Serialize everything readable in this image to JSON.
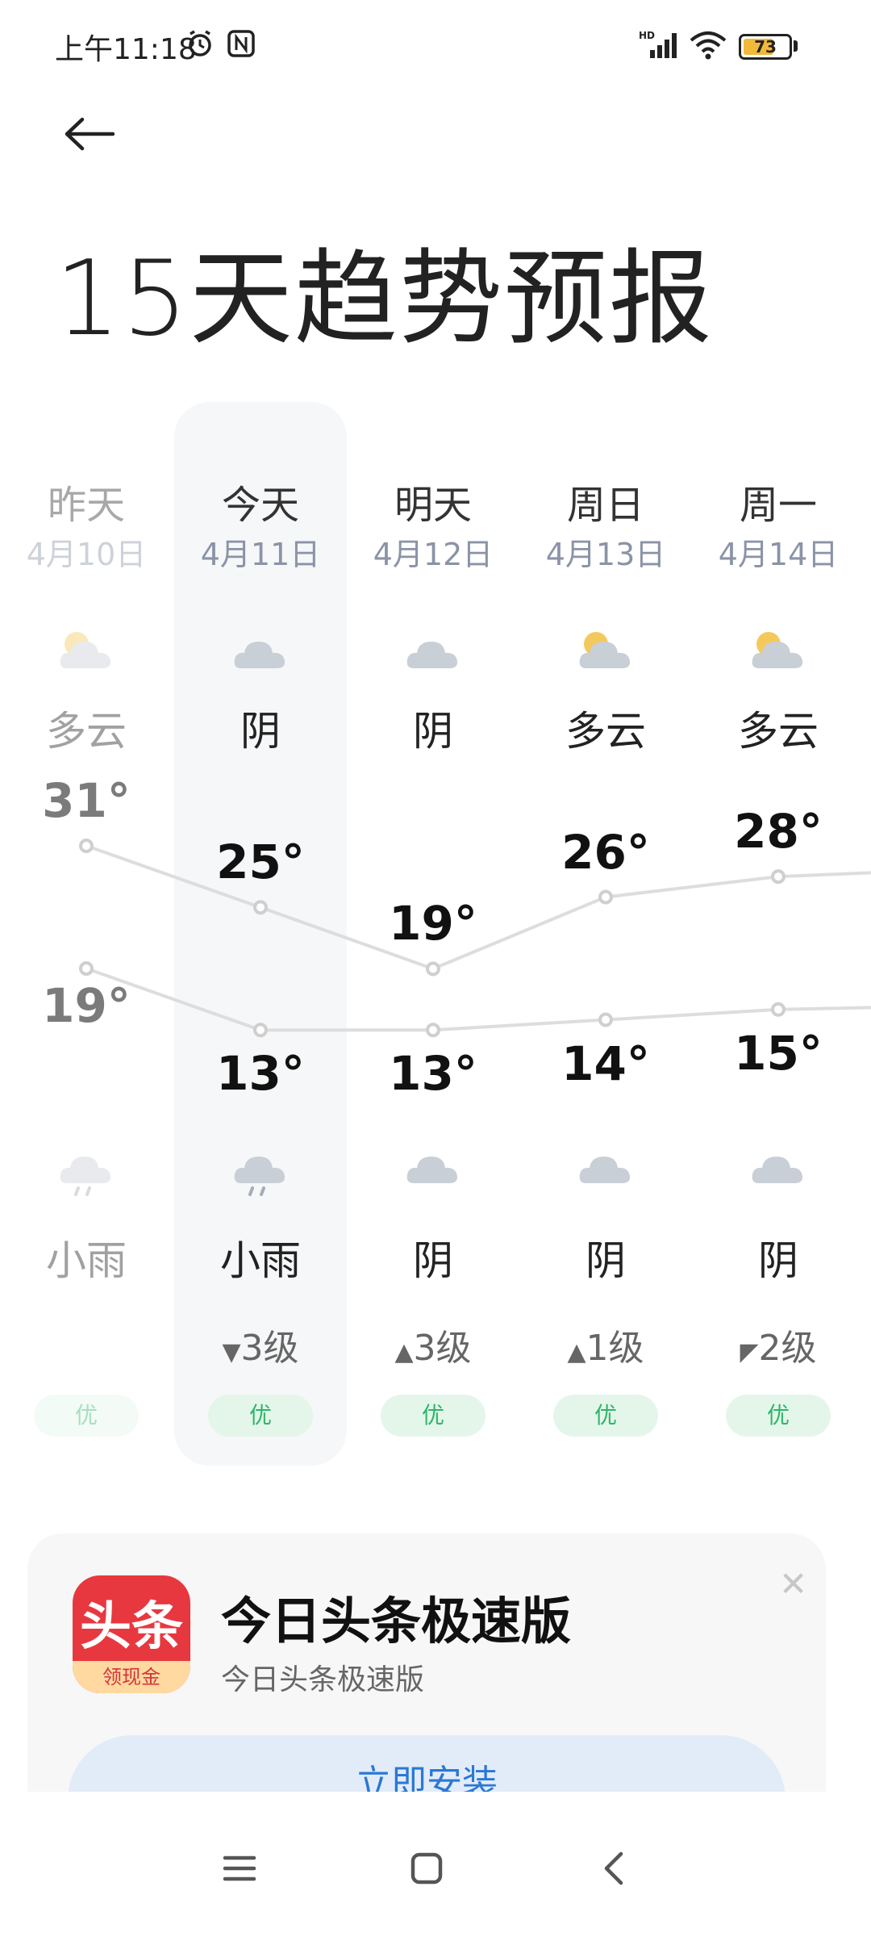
{
  "status_bar": {
    "time": "上午11:18",
    "battery": "73",
    "icons": [
      "alarm-icon",
      "nfc-icon",
      "hd-signal-icon",
      "wifi-icon",
      "battery-icon"
    ]
  },
  "header": {
    "back_icon": "arrow-left-icon",
    "title": "15天趋势预报"
  },
  "colors": {
    "line": "#dddddd",
    "aqi_bg": "#e4f6ea",
    "aqi_text": "#2db66a",
    "today_bg": "#f6f7f8",
    "accent": "#2a78d6"
  },
  "days": [
    {
      "name": "昨天",
      "date": "4月10日",
      "cond_day": "多云",
      "icon_day": "partly-cloudy-icon",
      "high": "31°",
      "low": "19°",
      "cond_night": "小雨",
      "icon_night": "light-rain-icon",
      "wind_dir": "",
      "wind": "",
      "aqi": "优"
    },
    {
      "name": "今天",
      "date": "4月11日",
      "cond_day": "阴",
      "icon_day": "cloud-icon",
      "high": "25°",
      "low": "13°",
      "cond_night": "小雨",
      "icon_night": "light-rain-icon",
      "wind_dir": "▼",
      "wind": "3级",
      "aqi": "优"
    },
    {
      "name": "明天",
      "date": "4月12日",
      "cond_day": "阴",
      "icon_day": "cloud-icon",
      "high": "19°",
      "low": "13°",
      "cond_night": "阴",
      "icon_night": "cloud-icon",
      "wind_dir": "▲",
      "wind": "3级",
      "aqi": "优"
    },
    {
      "name": "周日",
      "date": "4月13日",
      "cond_day": "多云",
      "icon_day": "partly-cloudy-icon",
      "high": "26°",
      "low": "14°",
      "cond_night": "阴",
      "icon_night": "cloud-icon",
      "wind_dir": "▲",
      "wind": "1级",
      "aqi": "优"
    },
    {
      "name": "周一",
      "date": "4月14日",
      "cond_day": "多云",
      "icon_day": "partly-cloudy-icon",
      "high": "28°",
      "low": "15°",
      "cond_night": "阴",
      "icon_night": "cloud-icon",
      "wind_dir": "◤",
      "wind": "2级",
      "aqi": "优"
    }
  ],
  "chart_data": {
    "type": "line",
    "categories": [
      "4月10日",
      "4月11日",
      "4月12日",
      "4月13日",
      "4月14日"
    ],
    "series": [
      {
        "values": [
          31,
          25,
          19,
          26,
          28
        ]
      },
      {
        "values": [
          19,
          13,
          13,
          14,
          15
        ]
      }
    ]
  },
  "ad": {
    "icon_text": "头条",
    "icon_strip": "领现金",
    "app_name": "今日头条极速版",
    "subtitle": "今日头条极速版",
    "install_label": "立即安装",
    "close_icon": "close-icon"
  },
  "navigation_bar": [
    "menu-icon",
    "home-icon",
    "back-icon"
  ]
}
